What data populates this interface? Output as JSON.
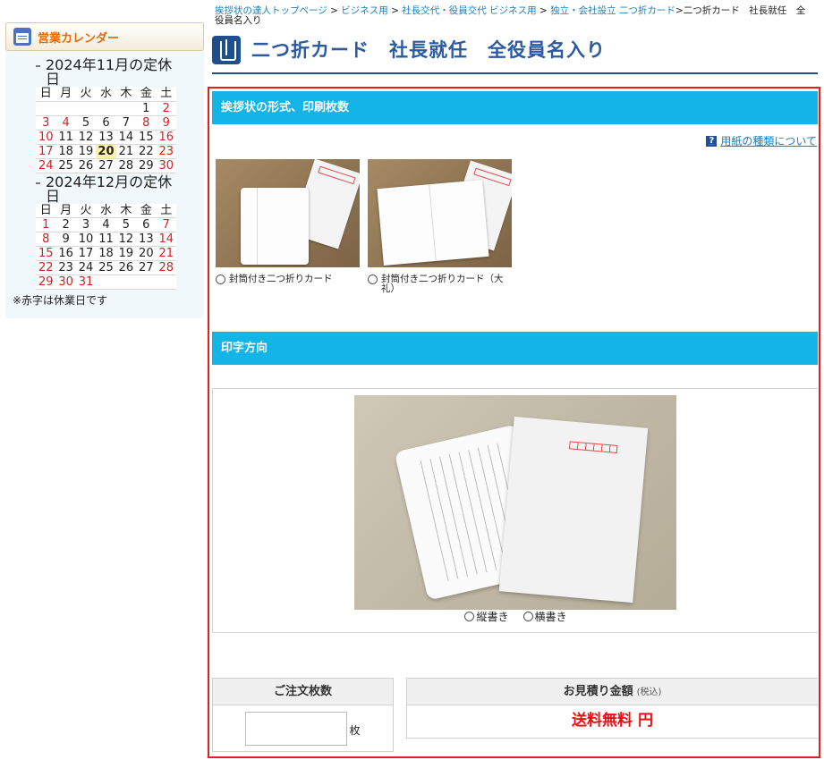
{
  "sidebar": {
    "calendar_title": "営業カレンダー",
    "weekdays": [
      "日",
      "月",
      "火",
      "水",
      "木",
      "金",
      "土"
    ],
    "months": [
      {
        "title": "2024年11月の定休日",
        "rows": [
          [
            "",
            "",
            "",
            "",
            "",
            "1",
            "2"
          ],
          [
            "3",
            "4",
            "5",
            "6",
            "7",
            "8",
            "9"
          ],
          [
            "10",
            "11",
            "12",
            "13",
            "14",
            "15",
            "16"
          ],
          [
            "17",
            "18",
            "19",
            "20",
            "21",
            "22",
            "23"
          ],
          [
            "24",
            "25",
            "26",
            "27",
            "28",
            "29",
            "30"
          ]
        ],
        "holidays": [
          "2",
          "3",
          "4",
          "8",
          "9",
          "10",
          "16",
          "17",
          "23",
          "24",
          "30"
        ],
        "today": "20"
      },
      {
        "title": "2024年12月の定休日",
        "rows": [
          [
            "1",
            "2",
            "3",
            "4",
            "5",
            "6",
            "7"
          ],
          [
            "8",
            "9",
            "10",
            "11",
            "12",
            "13",
            "14"
          ],
          [
            "15",
            "16",
            "17",
            "18",
            "19",
            "20",
            "21"
          ],
          [
            "22",
            "23",
            "24",
            "25",
            "26",
            "27",
            "28"
          ],
          [
            "29",
            "30",
            "31",
            "",
            "",
            "",
            ""
          ]
        ],
        "holidays": [
          "1",
          "7",
          "8",
          "14",
          "15",
          "21",
          "22",
          "28",
          "29",
          "30",
          "31"
        ],
        "today": ""
      }
    ],
    "note": "※赤字は休業日です"
  },
  "breadcrumb": {
    "items": [
      "挨拶状の達人トップページ",
      "ビジネス用",
      "社長交代・役員交代 ビジネス用",
      "独立・会社設立 二つ折カード"
    ],
    "separator": " > ",
    "current": ">二つ折カード　社長就任　全役員名入り"
  },
  "page": {
    "title": "二つ折カード　社長就任　全役員名入り"
  },
  "form": {
    "section1_title": "挨拶状の形式、印刷枚数",
    "help_link": "用紙の種類について",
    "paper_options": [
      {
        "label": "封筒付き二つ折りカード"
      },
      {
        "label": "封筒付き二つ折りカード（大礼）"
      }
    ],
    "section2_title": "印字方向",
    "direction_options": [
      "縦書き",
      "横書き"
    ],
    "quantity_header": "ご注文枚数",
    "quantity_value": "",
    "quantity_unit": "枚",
    "price_header": "お見積り金額",
    "price_tax_note": "(税込)",
    "price_text": "送料無料 円"
  },
  "colors": {
    "section_bar": "#14b4e6",
    "frame_border": "#e02020",
    "price_text": "#e81010",
    "holiday_text": "#d42020",
    "link": "#1a7fb8",
    "heading": "#2a5aa0"
  }
}
